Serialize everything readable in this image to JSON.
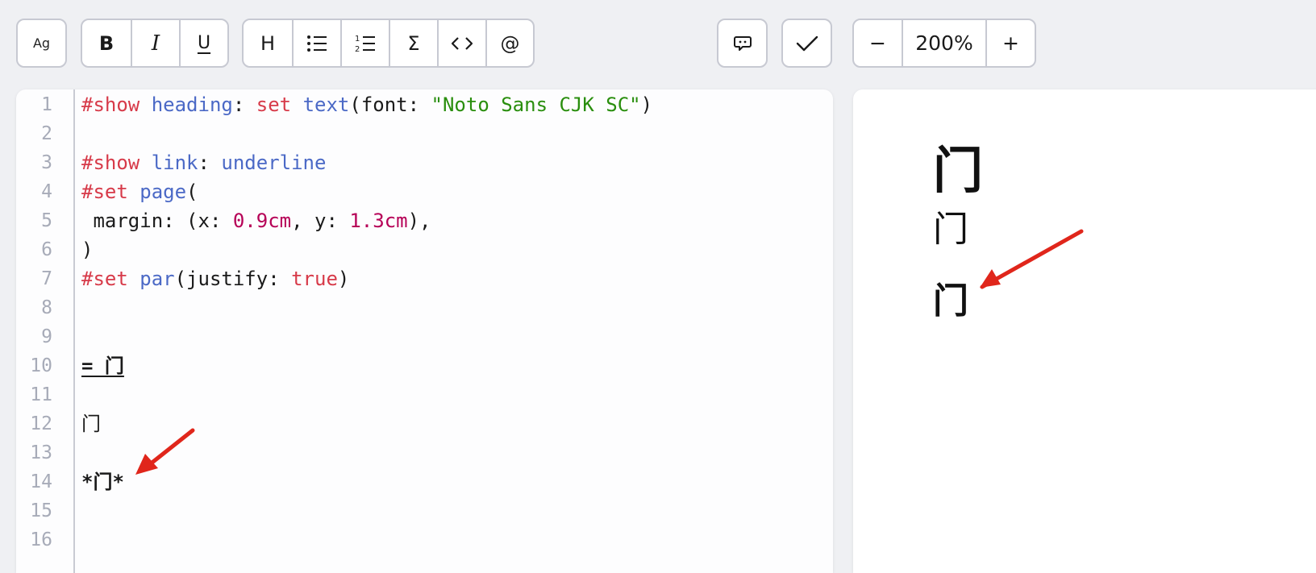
{
  "toolbar": {
    "font_button": "Ag",
    "bold_button": "B",
    "italic_button": "I",
    "underline_button": "U",
    "heading_button": "H",
    "math_button": "Σ",
    "mention_button": "@",
    "zoom_out": "−",
    "zoom_level": "200%",
    "zoom_in": "+"
  },
  "icons": {
    "bullet_list": "bullet-list-icon",
    "numbered_list": "numbered-list-icon",
    "code": "code-icon",
    "comment": "comment-icon",
    "check": "check-icon"
  },
  "editor": {
    "line_numbers": [
      "1",
      "2",
      "3",
      "4",
      "5",
      "6",
      "7",
      "8",
      "9",
      "10",
      "11",
      "12",
      "13",
      "14",
      "15",
      "16"
    ],
    "lines": {
      "l1": {
        "kw": "#show",
        "fn": "heading",
        "p1": ": ",
        "kw2": "set",
        "p2": " ",
        "fn2": "text",
        "p3": "(font: ",
        "str": "\"Noto Sans CJK SC\"",
        "p4": ")"
      },
      "l3": {
        "kw": "#show",
        "p0": " ",
        "fn": "link",
        "p1": ": ",
        "fn2": "underline"
      },
      "l4": {
        "kw": "#set",
        "p0": " ",
        "fn": "page",
        "p1": "("
      },
      "l5": {
        "p1": " margin: (x: ",
        "n1": "0.9cm",
        "p2": ", y: ",
        "n2": "1.3cm",
        "p3": "),"
      },
      "l6": {
        "p1": ")"
      },
      "l7": {
        "kw": "#set",
        "p0": " ",
        "fn": "par",
        "p1": "(justify: ",
        "bool": "true",
        "p2": ")"
      },
      "l10": {
        "heading": "= 门"
      },
      "l12": {
        "text": "门"
      },
      "l14": {
        "strong": "*门*"
      }
    }
  },
  "preview": {
    "heading": "门",
    "normal": "门",
    "bold": "门"
  },
  "colors": {
    "keyword": "#d73a49",
    "function": "#4b69c6",
    "string": "#298e0d",
    "number": "#b60157",
    "arrow": "#e0261b"
  }
}
